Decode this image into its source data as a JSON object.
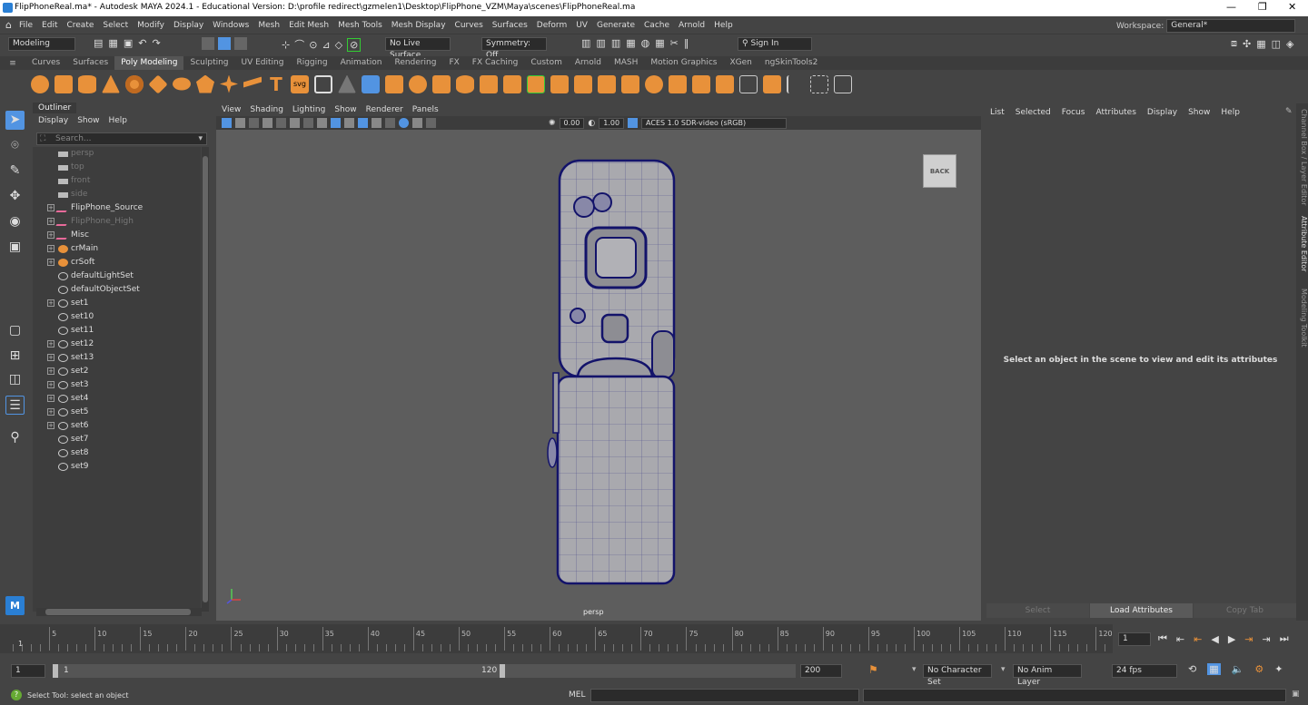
{
  "title": "FlipPhoneReal.ma* - Autodesk MAYA 2024.1 - Educational Version: D:\\profile redirect\\gzmelen1\\Desktop\\FlipPhone_VZM\\Maya\\scenes\\FlipPhoneReal.ma",
  "menubar": [
    "File",
    "Edit",
    "Create",
    "Select",
    "Modify",
    "Display",
    "Windows",
    "Mesh",
    "Edit Mesh",
    "Mesh Tools",
    "Mesh Display",
    "Curves",
    "Surfaces",
    "Deform",
    "UV",
    "Generate",
    "Cache",
    "Arnold",
    "Help"
  ],
  "workspace": {
    "label": "Workspace:",
    "value": "General*"
  },
  "status": {
    "mode": "Modeling",
    "live_surface": "No Live Surface",
    "symmetry": "Symmetry: Off",
    "sign_in": "Sign In"
  },
  "shelf_tabs": [
    "Curves",
    "Surfaces",
    "Poly Modeling",
    "Sculpting",
    "UV Editing",
    "Rigging",
    "Animation",
    "Rendering",
    "FX",
    "FX Caching",
    "Custom",
    "Arnold",
    "MASH",
    "Motion Graphics",
    "XGen",
    "ngSkinTools2"
  ],
  "shelf_active": "Poly Modeling",
  "shelf_svg_label": "svg",
  "outliner": {
    "tab": "Outliner",
    "menu": [
      "Display",
      "Show",
      "Help"
    ],
    "search_placeholder": "Search...",
    "items": [
      {
        "label": "persp",
        "dim": true,
        "exp": false,
        "icon": "camera-icon"
      },
      {
        "label": "top",
        "dim": true,
        "exp": false,
        "icon": "camera-icon"
      },
      {
        "label": "front",
        "dim": true,
        "exp": false,
        "icon": "camera-icon"
      },
      {
        "label": "side",
        "dim": true,
        "exp": false,
        "icon": "camera-icon"
      },
      {
        "label": "FlipPhone_Source",
        "dim": false,
        "exp": true,
        "icon": "transform-icon"
      },
      {
        "label": "FlipPhone_High",
        "dim": true,
        "exp": true,
        "icon": "transform-icon"
      },
      {
        "label": "Misc",
        "dim": false,
        "exp": true,
        "icon": "transform-icon"
      },
      {
        "label": "crMain",
        "dim": false,
        "exp": true,
        "icon": "layer-icon"
      },
      {
        "label": "crSoft",
        "dim": false,
        "exp": true,
        "icon": "layer-icon"
      },
      {
        "label": "defaultLightSet",
        "dim": false,
        "exp": false,
        "icon": "set-icon"
      },
      {
        "label": "defaultObjectSet",
        "dim": false,
        "exp": false,
        "icon": "set-icon"
      },
      {
        "label": "set1",
        "dim": false,
        "exp": true,
        "icon": "set-icon"
      },
      {
        "label": "set10",
        "dim": false,
        "exp": false,
        "icon": "set-icon"
      },
      {
        "label": "set11",
        "dim": false,
        "exp": false,
        "icon": "set-icon"
      },
      {
        "label": "set12",
        "dim": false,
        "exp": true,
        "icon": "set-icon"
      },
      {
        "label": "set13",
        "dim": false,
        "exp": true,
        "icon": "set-icon"
      },
      {
        "label": "set2",
        "dim": false,
        "exp": true,
        "icon": "set-icon"
      },
      {
        "label": "set3",
        "dim": false,
        "exp": true,
        "icon": "set-icon"
      },
      {
        "label": "set4",
        "dim": false,
        "exp": true,
        "icon": "set-icon"
      },
      {
        "label": "set5",
        "dim": false,
        "exp": true,
        "icon": "set-icon"
      },
      {
        "label": "set6",
        "dim": false,
        "exp": true,
        "icon": "set-icon"
      },
      {
        "label": "set7",
        "dim": false,
        "exp": false,
        "icon": "set-icon"
      },
      {
        "label": "set8",
        "dim": false,
        "exp": false,
        "icon": "set-icon"
      },
      {
        "label": "set9",
        "dim": false,
        "exp": false,
        "icon": "set-icon"
      }
    ]
  },
  "viewport": {
    "menu": [
      "View",
      "Shading",
      "Lighting",
      "Show",
      "Renderer",
      "Panels"
    ],
    "val1": "0.00",
    "val2": "1.00",
    "colorspace": "ACES 1.0 SDR-video (sRGB)",
    "camera_label": "persp",
    "viewcube": "BACK"
  },
  "right_panel": {
    "menu": [
      "List",
      "Selected",
      "Focus",
      "Attributes",
      "Display",
      "Show",
      "Help"
    ],
    "message": "Select an object in the scene to view and edit its attributes",
    "buttons": [
      "Select",
      "Load Attributes",
      "Copy Tab"
    ]
  },
  "side_tabs": [
    "Channel Box / Layer Editor",
    "Attribute Editor",
    "Modeling Toolkit"
  ],
  "timeline": {
    "ticks": [
      "5",
      "10",
      "15",
      "20",
      "25",
      "30",
      "35",
      "40",
      "45",
      "50",
      "55",
      "60",
      "65",
      "70",
      "75",
      "80",
      "85",
      "90",
      "95",
      "100",
      "105",
      "110",
      "115",
      "120"
    ],
    "start_label": "1",
    "current_frame": "1"
  },
  "range": {
    "start": "1",
    "inner_start": "1",
    "inner_end": "120",
    "end": "200",
    "character_set": "No Character Set",
    "anim_layer": "No Anim Layer",
    "fps": "24 fps"
  },
  "help_line": {
    "text": "Select Tool: select an object",
    "mel": "MEL"
  },
  "colors": {
    "accent": "#5294e2",
    "mesh_outline": "#1a1a7a",
    "shelf_orange": "#e8913a"
  }
}
